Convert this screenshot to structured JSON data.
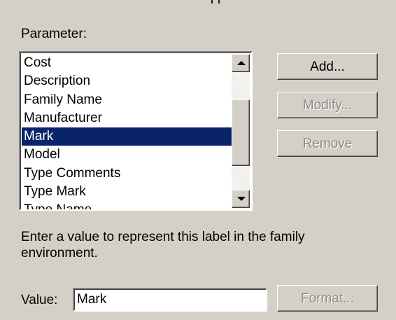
{
  "parameter_label": "Parameter:",
  "parameters": [
    "Cost",
    "Description",
    "Family Name",
    "Manufacturer",
    "Mark",
    "Model",
    "Type Comments",
    "Type Mark",
    "Type Name"
  ],
  "selected_parameter": "Mark",
  "buttons": {
    "add": "Add...",
    "modify": "Modify...",
    "remove": "Remove",
    "format": "Format..."
  },
  "hint": "Enter a value to represent this label in the family environment.",
  "value": {
    "label": "Value:",
    "text": "Mark"
  },
  "colors": {
    "background": "#d4d0c8",
    "selection": "#0a246a",
    "disabled_text": "#8c8a85"
  },
  "icons": {
    "scroll_up": "scroll-up-arrow-icon",
    "scroll_down": "scroll-down-arrow-icon"
  }
}
